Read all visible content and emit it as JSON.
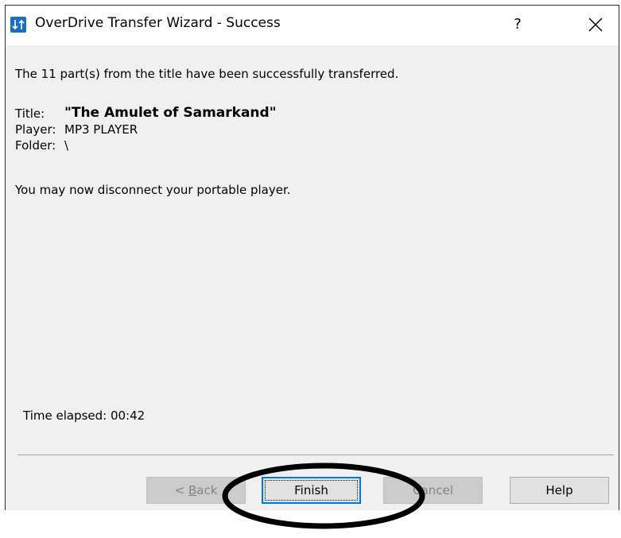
{
  "window": {
    "title": "OverDrive Transfer Wizard - Success",
    "help_symbol": "?",
    "icon": "transfer-arrows-icon",
    "close_icon": "close-icon"
  },
  "content": {
    "status_message": "The 11 part(s) from the title have been successfully transferred.",
    "fields": [
      {
        "label": "Title:",
        "value": "\"The Amulet of Samarkand\""
      },
      {
        "label": "Player:",
        "value": "MP3 PLAYER"
      },
      {
        "label": "Folder:",
        "value": "\\"
      }
    ],
    "disconnect_message": "You may now disconnect your portable player.",
    "time_elapsed": "Time elapsed: 00:42"
  },
  "buttons": {
    "back": {
      "label_prefix": "< ",
      "label_mnemonic": "B",
      "label_rest": "ack",
      "enabled": false
    },
    "finish": {
      "label": "Finish",
      "enabled": true,
      "default": true
    },
    "cancel": {
      "label": "Cancel",
      "enabled": false
    },
    "help": {
      "label": "Help",
      "enabled": true
    }
  },
  "colors": {
    "accent": "#0078d7",
    "app_icon": "#1a6fc1",
    "dialog_bg": "#f0f0f0",
    "disabled_text": "#838383"
  }
}
